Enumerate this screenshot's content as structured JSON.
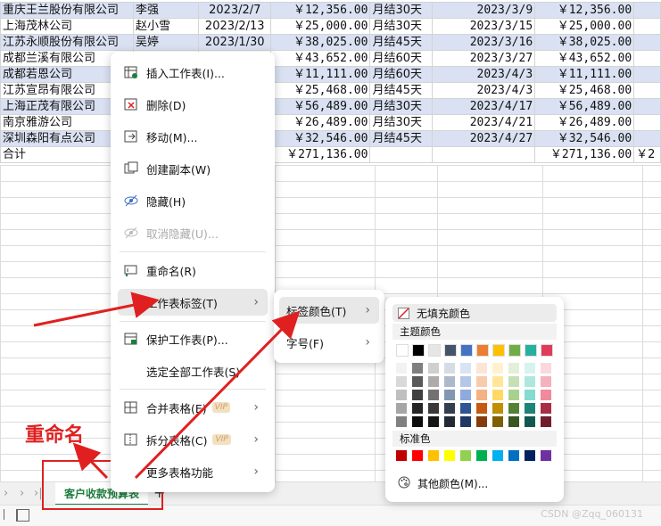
{
  "sheet": {
    "rows": [
      {
        "customer": "重庆王兰股份有限公司",
        "person": "李强",
        "date": "2023/2/7",
        "amount": "￥12,356.00",
        "terms": "月结30天",
        "due": "2023/3/9",
        "amount2": "￥12,356.00"
      },
      {
        "customer": "上海茂林公司",
        "person": "赵小雪",
        "date": "2023/2/13",
        "amount": "￥25,000.00",
        "terms": "月结30天",
        "due": "2023/3/15",
        "amount2": "￥25,000.00"
      },
      {
        "customer": "江苏永顺股份有限公司",
        "person": "吴婷",
        "date": "2023/1/30",
        "amount": "￥38,025.00",
        "terms": "月结45天",
        "due": "2023/3/16",
        "amount2": "￥38,025.00"
      },
      {
        "customer": "成都兰溪有限公司",
        "person": "",
        "date": "",
        "amount": "￥43,652.00",
        "terms": "月结60天",
        "due": "2023/3/27",
        "amount2": "￥43,652.00"
      },
      {
        "customer": "成都若恩公司",
        "person": "",
        "date": "",
        "amount": "￥11,111.00",
        "terms": "月结60天",
        "due": "2023/4/3",
        "amount2": "￥11,111.00"
      },
      {
        "customer": "江苏宣昂有限公司",
        "person": "",
        "date": "",
        "amount": "￥25,468.00",
        "terms": "月结45天",
        "due": "2023/4/3",
        "amount2": "￥25,468.00"
      },
      {
        "customer": "上海正茂有限公司",
        "person": "",
        "date": "",
        "amount": "￥56,489.00",
        "terms": "月结30天",
        "due": "2023/4/17",
        "amount2": "￥56,489.00"
      },
      {
        "customer": "南京雅游公司",
        "person": "",
        "date": "",
        "amount": "￥26,489.00",
        "terms": "月结30天",
        "due": "2023/4/21",
        "amount2": "￥26,489.00"
      },
      {
        "customer": "深圳森阳有点公司",
        "person": "",
        "date": "",
        "amount": "￥32,546.00",
        "terms": "月结45天",
        "due": "2023/4/27",
        "amount2": "￥32,546.00"
      }
    ],
    "total": {
      "label": "合计",
      "amount": "￥271,136.00",
      "amount2": "￥271,136.00",
      "last": "￥2"
    }
  },
  "context_menu": {
    "insert": "插入工作表(I)...",
    "delete": "删除(D)",
    "move": "移动(M)...",
    "copy": "创建副本(W)",
    "hide": "隐藏(H)",
    "unhide": "取消隐藏(U)...",
    "rename": "重命名(R)",
    "tab_label": "工作表标签(T)",
    "protect": "保护工作表(P)...",
    "select_all": "选定全部工作表(S)",
    "merge": "合并表格(E)",
    "split": "拆分表格(C)",
    "more": "更多表格功能",
    "vip": "VIP"
  },
  "submenu": {
    "tab_color": "标签颜色(T)",
    "font_size": "字号(F)"
  },
  "color_panel": {
    "no_fill": "无填充颜色",
    "theme_title": "主题颜色",
    "standard_title": "标准色",
    "other_colors": "其他颜色(M)...",
    "theme_top": [
      "#ffffff",
      "#000000",
      "#e7e6e6",
      "#44546a",
      "#4472c4",
      "#ed7d31",
      "#ffc000",
      "#70ad47",
      "#26b0a0",
      "#e03c5a"
    ],
    "theme_shades": [
      [
        "#f2f2f2",
        "#7f7f7f",
        "#d0cece",
        "#d6dce5",
        "#dae3f3",
        "#fbe5d6",
        "#fff2cc",
        "#e2f0d9",
        "#d6f3ef",
        "#fad8de"
      ],
      [
        "#d9d9d9",
        "#595959",
        "#aeabab",
        "#adb9ca",
        "#b4c7e7",
        "#f8cbad",
        "#ffe699",
        "#c5e0b4",
        "#ade7df",
        "#f5b1bd"
      ],
      [
        "#bfbfbf",
        "#404040",
        "#757171",
        "#8497b0",
        "#8faadc",
        "#f4b183",
        "#ffd966",
        "#a9d18e",
        "#84dbcf",
        "#f08a9c"
      ],
      [
        "#a6a6a6",
        "#262626",
        "#3a3838",
        "#333f50",
        "#2f5597",
        "#c55a11",
        "#bf9000",
        "#548235",
        "#1c847a",
        "#a82d44"
      ],
      [
        "#808080",
        "#0d0d0d",
        "#171616",
        "#222a35",
        "#1f3864",
        "#843c0c",
        "#7f6000",
        "#385723",
        "#135850",
        "#701e2d"
      ]
    ],
    "standard": [
      "#c00000",
      "#ff0000",
      "#ffc000",
      "#ffff00",
      "#92d050",
      "#00b050",
      "#00b0f0",
      "#0070c0",
      "#002060",
      "#7030a0"
    ]
  },
  "sheet_tab": {
    "name": "客户收款预算表",
    "add": "+"
  },
  "annotation": {
    "label": "重命名"
  },
  "watermark": "CSDN @Zqq_060131",
  "colors": {
    "accent": "#1e7e3e",
    "annotation": "#e02020",
    "highlight_row": "#d9e1f2"
  }
}
